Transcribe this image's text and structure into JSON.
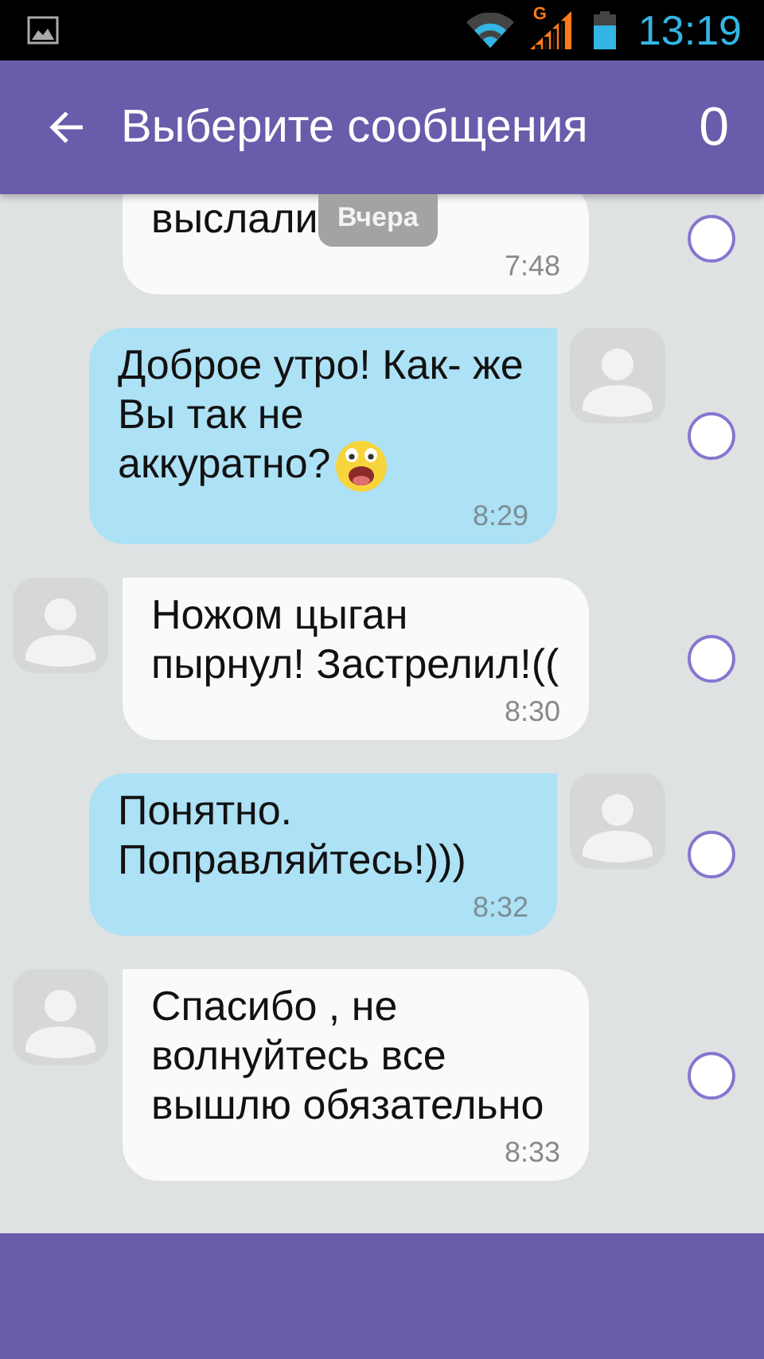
{
  "status_bar": {
    "network_type": "G",
    "time": "13:19"
  },
  "app_bar": {
    "title": "Выберите сообщения",
    "count": "0"
  },
  "date_chip": "Вчера",
  "messages": [
    {
      "kind": "incoming",
      "text": "выслали",
      "time": "7:48",
      "selected": false,
      "avatar": false
    },
    {
      "kind": "outgoing",
      "text": "Доброе утро! Как- же Вы так не аккуратно?",
      "trailing_emoji": true,
      "time": "8:29",
      "selected": false,
      "avatar": true
    },
    {
      "kind": "incoming",
      "text": "Ножом цыган пырнул! Застрелил!((",
      "time": "8:30",
      "selected": false,
      "avatar": true
    },
    {
      "kind": "outgoing",
      "text": "Понятно. Поправляйтесь!)))",
      "time": "8:32",
      "selected": false,
      "avatar": true
    },
    {
      "kind": "incoming",
      "text": "Спасибо , не волнуйтесь все вышлю обязательно",
      "time": "8:33",
      "selected": false,
      "avatar": true
    }
  ]
}
